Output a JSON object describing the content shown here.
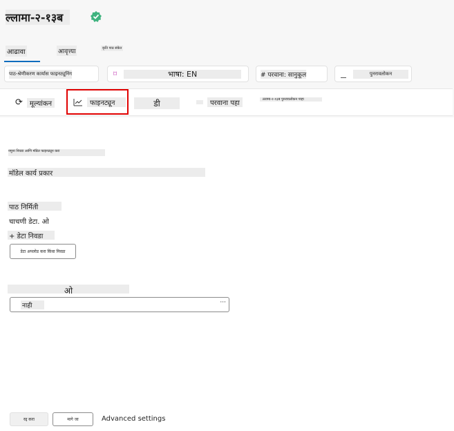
{
  "header": {
    "model_name": "ल्लामा-२-१३ब",
    "tabs": [
      {
        "label": "आढावा"
      },
      {
        "label": "आवृत्त्या"
      },
      {
        "label": "कृति पाठ संकेत"
      }
    ]
  },
  "pills": [
    {
      "label": "पाठ-श्रेणीकरण कार्यास फाइनट्यूनिंग"
    },
    {
      "label": "भाषा: EN"
    },
    {
      "label": "# परवाना: सानुकूल"
    },
    {
      "label": "पुनरावलोकन"
    }
  ],
  "toolbar": {
    "evaluate_label": "मूल्यांकन",
    "finetune_label": "फाइनट्यून",
    "deploy_label": "डी",
    "license_label": "परवाना पहा",
    "more_label": "ल्लामा-२-१३ब पुनरावलोकन पाहा"
  },
  "form": {
    "section_hint": "नमुना निवडा आणि मॉडेल फाइनट्यून करा",
    "model_task_label": "मॉडेल कार्य प्रकार",
    "text_generation_label": "पाठ निर्मिती",
    "test_data_label": "चाचणी डेटा. ओ",
    "add_data_label": "+ डेटा निवडा",
    "browse_button_label": "डेटा अपलोड करा किंवा निवडा",
    "option_label": "ओ",
    "option_hint": "पर्याय",
    "select_value": "नाही",
    "select_more": "···"
  },
  "footer": {
    "cancel_label": "रद्द करा",
    "back_label": "मागे जा",
    "advanced_label": "Advanced settings"
  },
  "colors": {
    "accent": "#0f6cbd",
    "highlight": "#e00000",
    "verified": "#3fb37f"
  }
}
